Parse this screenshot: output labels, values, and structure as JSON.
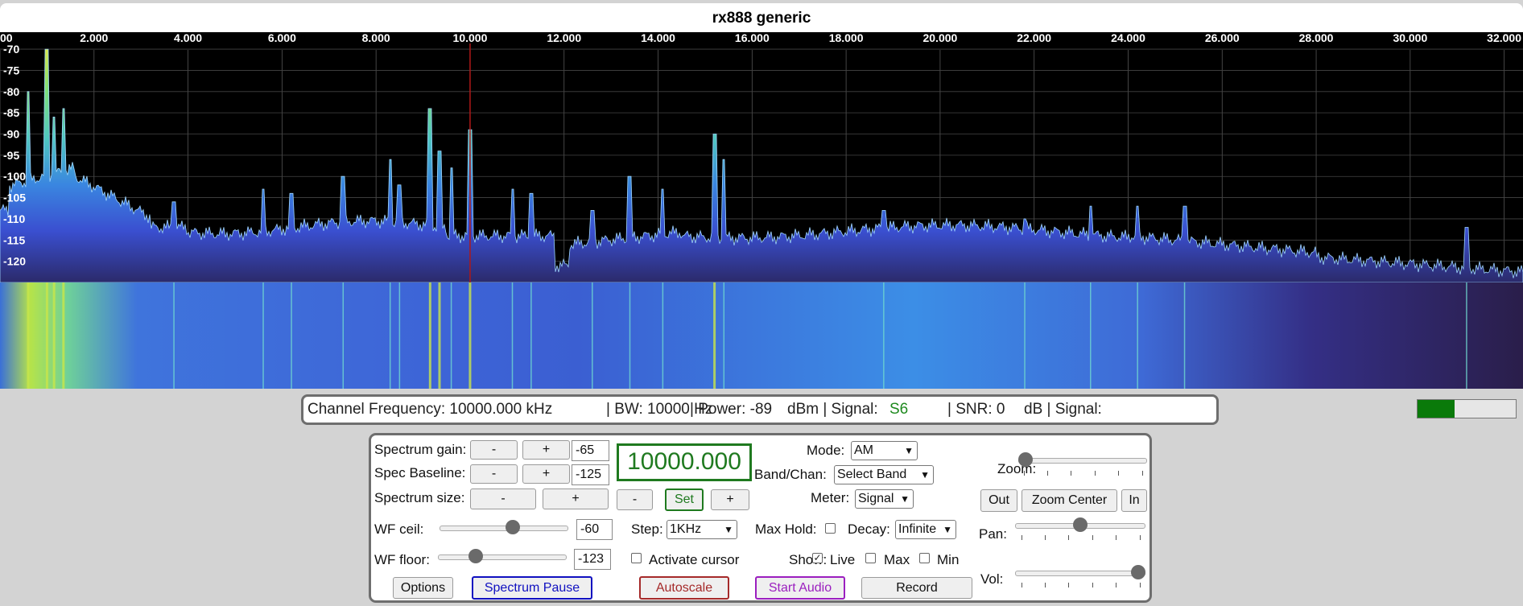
{
  "title": "rx888 generic",
  "spectrum": {
    "freq_ticks": [
      "00",
      "2.000",
      "4.000",
      "6.000",
      "8.000",
      "10.000",
      "12.000",
      "14.000",
      "16.000",
      "18.000",
      "20.000",
      "22.000",
      "24.000",
      "26.000",
      "28.000",
      "30.000",
      "32.000"
    ],
    "db_ticks": [
      "-70",
      "-75",
      "-80",
      "-85",
      "-90",
      "-95",
      "-100",
      "-105",
      "-110",
      "-115",
      "-120"
    ],
    "tuned_freq_khz": 10000
  },
  "info": {
    "channel_frequency": "Channel Frequency: 10000.000 kHz",
    "bw": "| BW: 10000 Hz",
    "power": "| Power: -89",
    "dbm": "dBm | Signal:",
    "signal_value": "S6",
    "snr": "| SNR: 0",
    "db_signal": "dB | Signal:",
    "signal_meter_level": 0.38
  },
  "controls": {
    "spectrum_gain_label": "Spectrum gain:",
    "spec_baseline_label": "Spec Baseline:",
    "spectrum_size_label": "Spectrum size:",
    "minus": "-",
    "plus": "+",
    "spectrum_gain_value": "-65",
    "spec_baseline_value": "-125",
    "frequency_display": "10000.000",
    "set_label": "Set",
    "wf_ceil_label": "WF ceil:",
    "wf_ceil_value": "-60",
    "wf_ceil_level": 0.58,
    "wf_floor_label": "WF floor:",
    "wf_floor_value": "-123",
    "wf_floor_level": 0.27,
    "step_label": "Step:",
    "step_value": "1KHz",
    "activate_cursor_label": "Activate cursor",
    "mode_label": "Mode:",
    "mode_value": "AM",
    "band_label": "Band/Chan:",
    "band_value": "Select Band",
    "meter_label": "Meter:",
    "meter_value": "Signal",
    "max_hold_label": "Max Hold:",
    "decay_label": "Decay:",
    "decay_value": "Infinite",
    "show_label": "Show:",
    "live_label": "Live",
    "max_label": "Max",
    "min_label": "Min",
    "zoom_label": "Zoom:",
    "zoom_level": 0.0,
    "out_label": "Out",
    "zoom_center_label": "Zoom Center",
    "in_label": "In",
    "pan_label": "Pan:",
    "pan_level": 0.5,
    "vol_label": "Vol:",
    "vol_level": 1.0,
    "options_label": "Options",
    "spectrum_pause_label": "Spectrum Pause",
    "autoscale_label": "Autoscale",
    "start_audio_label": "Start Audio",
    "record_label": "Record"
  },
  "colors": {
    "set_green": "#1f7a1f",
    "pause_blue": "#1010c0",
    "autoscale_red": "#a52a2a",
    "audio_purple": "#9b1fbf",
    "tuned_marker": "#b01818"
  }
}
